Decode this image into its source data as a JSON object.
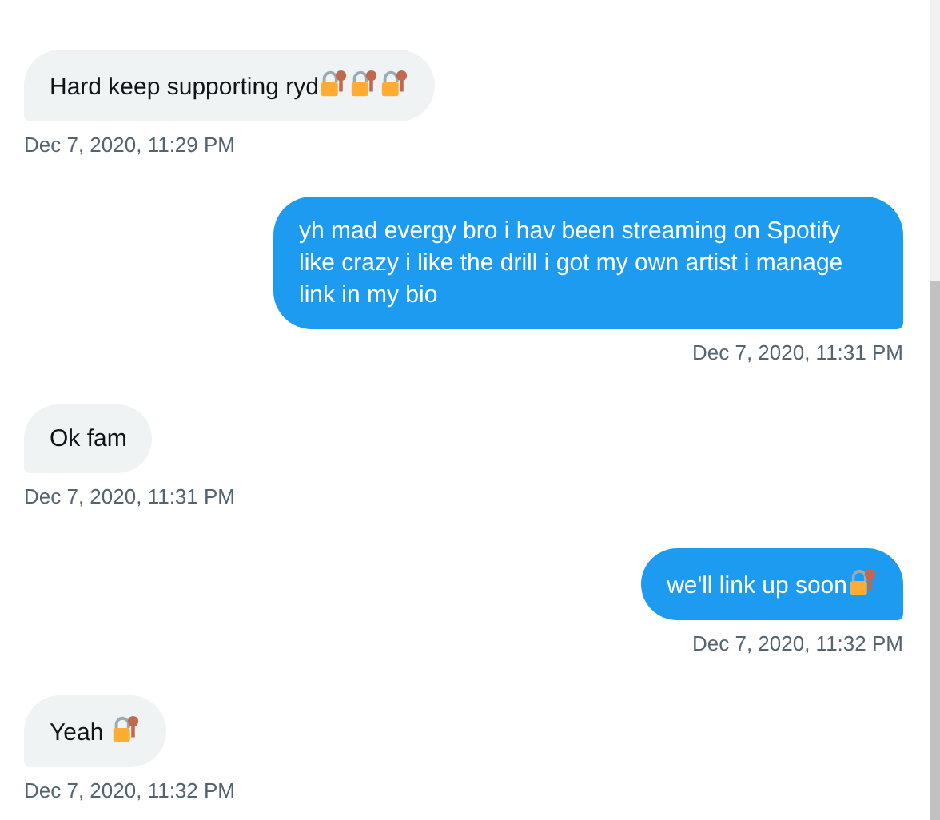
{
  "messages": [
    {
      "kind": "received",
      "parts": [
        {
          "kind": "text",
          "text": "Hard keep supporting ryd"
        },
        {
          "kind": "icon"
        },
        {
          "kind": "icon"
        },
        {
          "kind": "icon"
        }
      ],
      "time": "Dec 7, 2020, 11:29 PM"
    },
    {
      "kind": "sent",
      "parts": [
        {
          "kind": "text",
          "text": "yh mad evergy bro i hav been streaming on Spotify like crazy i like the drill i got my own artist i manage link in my bio"
        }
      ],
      "time": "Dec 7, 2020, 11:31 PM"
    },
    {
      "kind": "received",
      "parts": [
        {
          "kind": "text",
          "text": "Ok fam"
        }
      ],
      "time": "Dec 7, 2020, 11:31 PM"
    },
    {
      "kind": "sent",
      "parts": [
        {
          "kind": "text",
          "text": "we'll link up soon"
        },
        {
          "kind": "icon"
        }
      ],
      "time": "Dec 7, 2020, 11:32 PM"
    },
    {
      "kind": "received",
      "parts": [
        {
          "kind": "text",
          "text": "Yeah "
        },
        {
          "kind": "icon"
        }
      ],
      "time": "Dec 7, 2020, 11:32 PM"
    }
  ]
}
